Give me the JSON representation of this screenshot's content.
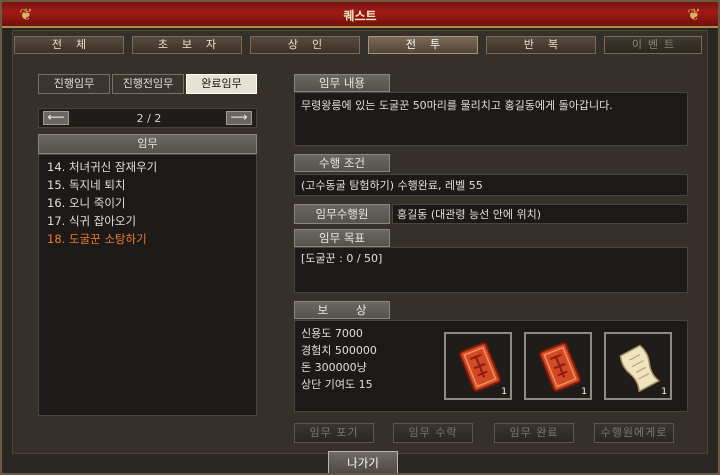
{
  "window": {
    "title": "퀘스트"
  },
  "tabs": [
    {
      "label": "전체",
      "state": "normal"
    },
    {
      "label": "초보자",
      "state": "normal"
    },
    {
      "label": "상인",
      "state": "normal"
    },
    {
      "label": "전투",
      "state": "active"
    },
    {
      "label": "반복",
      "state": "normal"
    },
    {
      "label": "이벤트",
      "state": "disabled"
    }
  ],
  "subtabs": [
    {
      "label": "진행임무",
      "state": "normal"
    },
    {
      "label": "진행전임무",
      "state": "normal"
    },
    {
      "label": "완료임무",
      "state": "active"
    }
  ],
  "pager": {
    "text": "2 / 2",
    "prev": "⟵",
    "next": "⟶"
  },
  "list": {
    "header": "임무",
    "items": [
      {
        "label": "14. 처녀귀신 잠재우기",
        "selected": false
      },
      {
        "label": "15. 독지네 퇴치",
        "selected": false
      },
      {
        "label": "16. 오니 죽이기",
        "selected": false
      },
      {
        "label": "17. 식귀 잡아오기",
        "selected": false
      },
      {
        "label": "18. 도굴꾼 소탕하기",
        "selected": true
      }
    ]
  },
  "details": {
    "content_label": "임무 내용",
    "content_text": "무령왕릉에 있는 도굴꾼 50마리를 물리치고 홍길동에게 돌아갑니다.",
    "condition_label": "수행 조건",
    "condition_text": "(고수동굴 탐험하기) 수행완료, 레벨 55",
    "npc_label": "임무수행원",
    "npc_text": "홍길동 (대관령 능선 안에 위치)",
    "goal_label": "임무 목표",
    "goal_text": "[도굴꾼 : 0 / 50]",
    "reward_label": "보 상",
    "reward_lines": [
      "신용도 7000",
      "경험치 500000",
      "돈 300000냥",
      "상단 기여도 15"
    ],
    "reward_items": [
      {
        "icon": "talisman-icon",
        "count": "1"
      },
      {
        "icon": "talisman-icon",
        "count": "1"
      },
      {
        "icon": "scroll-icon",
        "count": "1"
      }
    ]
  },
  "buttons": {
    "abandon": "임무 포기",
    "accept": "임무 수락",
    "complete": "임무 완료",
    "to_npc": "수행원에게로",
    "exit": "나가기"
  },
  "colors": {
    "title_bar": "#a11a15",
    "selected_item": "#f07a2e",
    "gold_trim": "#b08a4a"
  }
}
